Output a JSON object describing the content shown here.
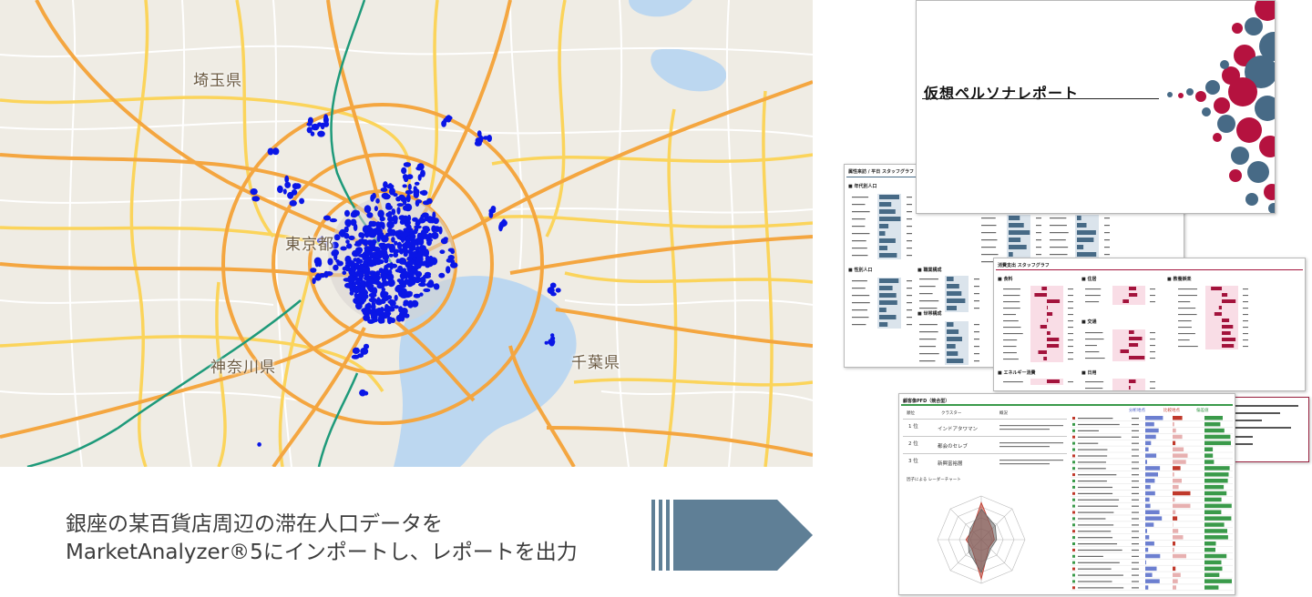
{
  "map": {
    "labels": {
      "saitama": "埼玉県",
      "tokyo": "東京都",
      "kanagawa": "神奈川県",
      "chiba": "千葉県"
    },
    "colors": {
      "land": "#efece4",
      "sea": "#bcd7f0",
      "expressway": "#f4a640",
      "road": "#fbd45b",
      "minor": "#ffffff",
      "rail_green": "#1e9a7a",
      "points": "#0a16e6"
    }
  },
  "caption": {
    "line1": "銀座の某百貨店周辺の滞在人口データを",
    "line2": "MarketAnalyzer®5にインポートし、レポートを出力"
  },
  "arrow": {
    "color": "#5f7f96",
    "icon": "arrow-right-icon"
  },
  "reports": {
    "cover": {
      "title": "仮想ペルソナレポート",
      "accent": "#b5123f",
      "secondary": "#476a86"
    },
    "blue_page": {
      "header": "属性来訪 / 平日 スタッフグラフ",
      "sec_age": "■ 年代別人口",
      "sec_gender": "■ 性別人口",
      "sec_job": "■ 職業構成",
      "sec_house": "■ 世帯構成",
      "bar_color": "#476a86",
      "bg_color": "#dbe4ec"
    },
    "pink_page": {
      "header": "消費支出 スタッフグラフ",
      "sec_food": "■ 食料",
      "sec_house": "■ 住居",
      "sec_culture": "■ 教養娯楽",
      "sec_transport": "■ 交通",
      "sec_energy": "■ エネルギー消費",
      "sec_daily": "■ 日用",
      "bar_color": "#a3133c",
      "bg_color": "#f9dde6"
    },
    "green_page": {
      "header": "顧客像PFD（競合型）",
      "col_rank": "順位",
      "col_cluster": "クラスター",
      "col_desc": "概況",
      "rank1": "1 位",
      "rank2": "2 位",
      "rank3": "3 位",
      "cluster1": "インドアタワマン",
      "cluster2": "都会のセレブ",
      "cluster3": "新興富裕層",
      "radar_title": "因子による レーダーチャート",
      "legend_a": "分析地点",
      "legend_b": "比較地点",
      "legend_c": "偏差値",
      "green_color": "#3a9a4a",
      "bar_blue": "#6c7fd0",
      "bar_red": "#c0392b"
    }
  }
}
